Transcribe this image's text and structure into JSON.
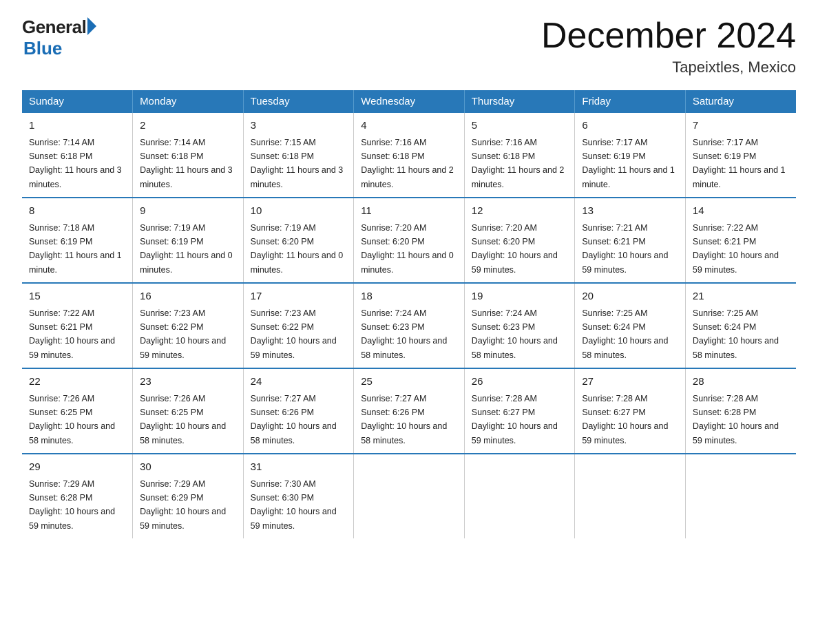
{
  "header": {
    "logo_general": "General",
    "logo_blue": "Blue",
    "month_year": "December 2024",
    "location": "Tapeixtles, Mexico"
  },
  "days_of_week": [
    "Sunday",
    "Monday",
    "Tuesday",
    "Wednesday",
    "Thursday",
    "Friday",
    "Saturday"
  ],
  "weeks": [
    [
      {
        "day": "1",
        "sunrise": "7:14 AM",
        "sunset": "6:18 PM",
        "daylight": "11 hours and 3 minutes."
      },
      {
        "day": "2",
        "sunrise": "7:14 AM",
        "sunset": "6:18 PM",
        "daylight": "11 hours and 3 minutes."
      },
      {
        "day": "3",
        "sunrise": "7:15 AM",
        "sunset": "6:18 PM",
        "daylight": "11 hours and 3 minutes."
      },
      {
        "day": "4",
        "sunrise": "7:16 AM",
        "sunset": "6:18 PM",
        "daylight": "11 hours and 2 minutes."
      },
      {
        "day": "5",
        "sunrise": "7:16 AM",
        "sunset": "6:18 PM",
        "daylight": "11 hours and 2 minutes."
      },
      {
        "day": "6",
        "sunrise": "7:17 AM",
        "sunset": "6:19 PM",
        "daylight": "11 hours and 1 minute."
      },
      {
        "day": "7",
        "sunrise": "7:17 AM",
        "sunset": "6:19 PM",
        "daylight": "11 hours and 1 minute."
      }
    ],
    [
      {
        "day": "8",
        "sunrise": "7:18 AM",
        "sunset": "6:19 PM",
        "daylight": "11 hours and 1 minute."
      },
      {
        "day": "9",
        "sunrise": "7:19 AM",
        "sunset": "6:19 PM",
        "daylight": "11 hours and 0 minutes."
      },
      {
        "day": "10",
        "sunrise": "7:19 AM",
        "sunset": "6:20 PM",
        "daylight": "11 hours and 0 minutes."
      },
      {
        "day": "11",
        "sunrise": "7:20 AM",
        "sunset": "6:20 PM",
        "daylight": "11 hours and 0 minutes."
      },
      {
        "day": "12",
        "sunrise": "7:20 AM",
        "sunset": "6:20 PM",
        "daylight": "10 hours and 59 minutes."
      },
      {
        "day": "13",
        "sunrise": "7:21 AM",
        "sunset": "6:21 PM",
        "daylight": "10 hours and 59 minutes."
      },
      {
        "day": "14",
        "sunrise": "7:22 AM",
        "sunset": "6:21 PM",
        "daylight": "10 hours and 59 minutes."
      }
    ],
    [
      {
        "day": "15",
        "sunrise": "7:22 AM",
        "sunset": "6:21 PM",
        "daylight": "10 hours and 59 minutes."
      },
      {
        "day": "16",
        "sunrise": "7:23 AM",
        "sunset": "6:22 PM",
        "daylight": "10 hours and 59 minutes."
      },
      {
        "day": "17",
        "sunrise": "7:23 AM",
        "sunset": "6:22 PM",
        "daylight": "10 hours and 59 minutes."
      },
      {
        "day": "18",
        "sunrise": "7:24 AM",
        "sunset": "6:23 PM",
        "daylight": "10 hours and 58 minutes."
      },
      {
        "day": "19",
        "sunrise": "7:24 AM",
        "sunset": "6:23 PM",
        "daylight": "10 hours and 58 minutes."
      },
      {
        "day": "20",
        "sunrise": "7:25 AM",
        "sunset": "6:24 PM",
        "daylight": "10 hours and 58 minutes."
      },
      {
        "day": "21",
        "sunrise": "7:25 AM",
        "sunset": "6:24 PM",
        "daylight": "10 hours and 58 minutes."
      }
    ],
    [
      {
        "day": "22",
        "sunrise": "7:26 AM",
        "sunset": "6:25 PM",
        "daylight": "10 hours and 58 minutes."
      },
      {
        "day": "23",
        "sunrise": "7:26 AM",
        "sunset": "6:25 PM",
        "daylight": "10 hours and 58 minutes."
      },
      {
        "day": "24",
        "sunrise": "7:27 AM",
        "sunset": "6:26 PM",
        "daylight": "10 hours and 58 minutes."
      },
      {
        "day": "25",
        "sunrise": "7:27 AM",
        "sunset": "6:26 PM",
        "daylight": "10 hours and 58 minutes."
      },
      {
        "day": "26",
        "sunrise": "7:28 AM",
        "sunset": "6:27 PM",
        "daylight": "10 hours and 59 minutes."
      },
      {
        "day": "27",
        "sunrise": "7:28 AM",
        "sunset": "6:27 PM",
        "daylight": "10 hours and 59 minutes."
      },
      {
        "day": "28",
        "sunrise": "7:28 AM",
        "sunset": "6:28 PM",
        "daylight": "10 hours and 59 minutes."
      }
    ],
    [
      {
        "day": "29",
        "sunrise": "7:29 AM",
        "sunset": "6:28 PM",
        "daylight": "10 hours and 59 minutes."
      },
      {
        "day": "30",
        "sunrise": "7:29 AM",
        "sunset": "6:29 PM",
        "daylight": "10 hours and 59 minutes."
      },
      {
        "day": "31",
        "sunrise": "7:30 AM",
        "sunset": "6:30 PM",
        "daylight": "10 hours and 59 minutes."
      },
      null,
      null,
      null,
      null
    ]
  ]
}
